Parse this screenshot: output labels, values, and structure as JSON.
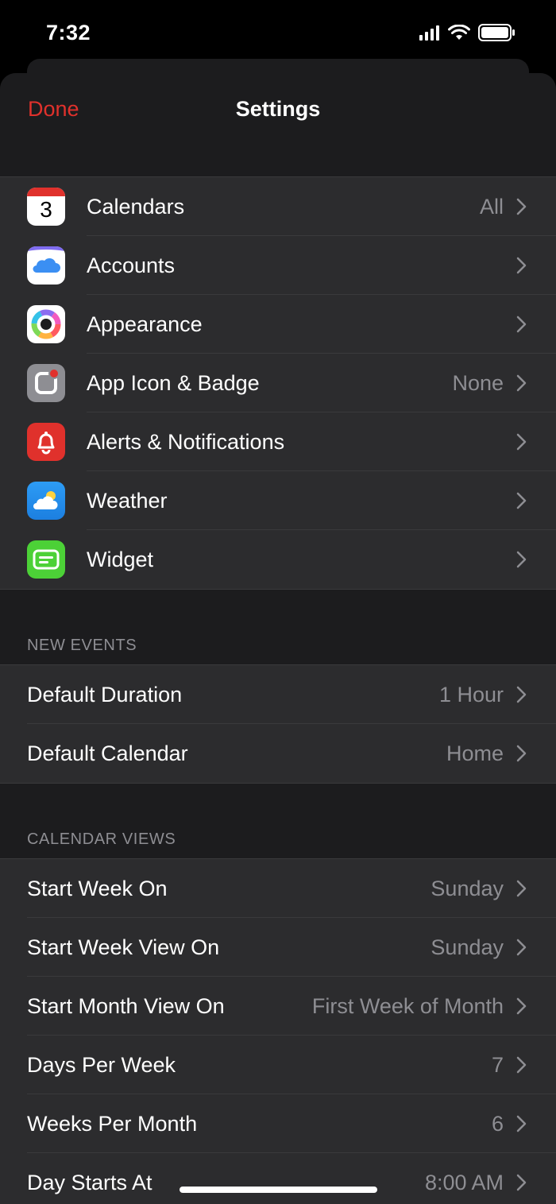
{
  "status": {
    "time": "7:32"
  },
  "nav": {
    "done": "Done",
    "title": "Settings"
  },
  "calendar_icon_number": "3",
  "general": [
    {
      "label": "Calendars",
      "value": "All",
      "icon": "calendar-icon"
    },
    {
      "label": "Accounts",
      "value": "",
      "icon": "cloud-icon"
    },
    {
      "label": "Appearance",
      "value": "",
      "icon": "color-wheel-icon"
    },
    {
      "label": "App Icon & Badge",
      "value": "None",
      "icon": "app-badge-icon"
    },
    {
      "label": "Alerts & Notifications",
      "value": "",
      "icon": "bell-icon"
    },
    {
      "label": "Weather",
      "value": "",
      "icon": "weather-icon"
    },
    {
      "label": "Widget",
      "value": "",
      "icon": "widget-icon"
    }
  ],
  "new_events": {
    "header": "NEW EVENTS",
    "rows": [
      {
        "label": "Default Duration",
        "value": "1 Hour"
      },
      {
        "label": "Default Calendar",
        "value": "Home"
      }
    ]
  },
  "calendar_views": {
    "header": "CALENDAR VIEWS",
    "rows": [
      {
        "label": "Start Week On",
        "value": "Sunday"
      },
      {
        "label": "Start Week View On",
        "value": "Sunday"
      },
      {
        "label": "Start Month View On",
        "value": "First Week of Month"
      },
      {
        "label": "Days Per Week",
        "value": "7"
      },
      {
        "label": "Weeks Per Month",
        "value": "6"
      },
      {
        "label": "Day Starts At",
        "value": "8:00 AM"
      }
    ]
  },
  "colors": {
    "accent": "#e0312c",
    "row_bg": "#2c2c2e",
    "secondary_text": "#8e8e93"
  }
}
